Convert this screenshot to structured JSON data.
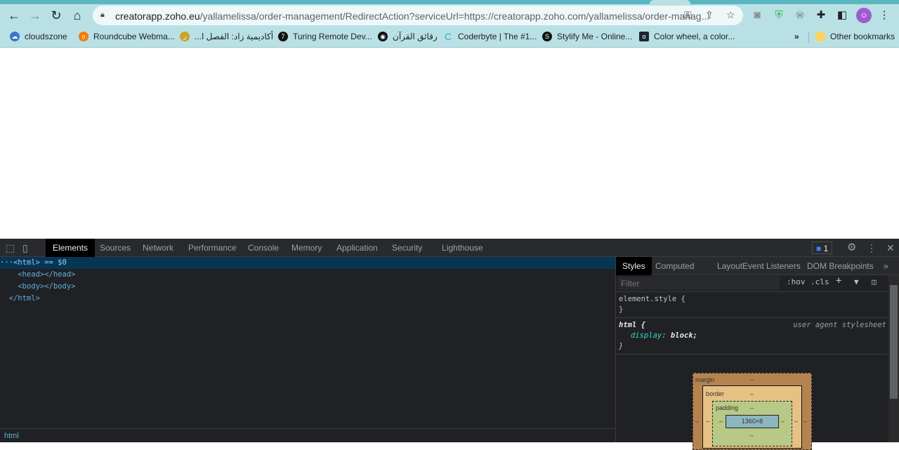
{
  "browser": {
    "url_host": "creatorapp.zoho.eu",
    "url_rest": "/yallamelissa/order-management/RedirectAction?serviceUrl=https://creatorapp.zoho.com/yallamelissa/order-manag...",
    "bookmarks": [
      {
        "label": "cloudszone",
        "icon": "cloud-icon"
      },
      {
        "label": "Roundcube Webma...",
        "icon": "roundcube-icon"
      },
      {
        "label": "أكاديمية زاد: الفصل ا...",
        "icon": "zad-icon"
      },
      {
        "label": "Turing Remote Dev...",
        "icon": "turing-icon"
      },
      {
        "label": "رقائق القرآن",
        "icon": "globe-icon"
      },
      {
        "label": "Coderbyte | The #1...",
        "icon": "coderbyte-icon"
      },
      {
        "label": "Stylify Me - Online...",
        "icon": "stylify-icon"
      },
      {
        "label": "Color wheel, a color...",
        "icon": "colorwheel-icon"
      }
    ],
    "overflow": "»",
    "other_bookmarks": "Other bookmarks"
  },
  "devtools": {
    "tabs": [
      "Elements",
      "Sources",
      "Network",
      "Performance",
      "Console",
      "Memory",
      "Application",
      "Security",
      "Lighthouse"
    ],
    "active_tab": "Elements",
    "issues_count": "1",
    "dom": [
      "···<html> == $0",
      "    <head></head>",
      "    <body></body>",
      "  </html>"
    ],
    "breadcrumb": "html",
    "side_tabs": [
      "Styles",
      "Computed",
      "Layout",
      "Event Listeners",
      "DOM Breakpoints",
      "»"
    ],
    "filter_placeholder": "Filter",
    "hov": ":hov",
    "cls": ".cls",
    "rules": {
      "element_selector": "element.style {",
      "close": "}",
      "html_selector": "html {",
      "source": "user agent stylesheet",
      "prop": "display",
      "value": "block;"
    },
    "box_model": {
      "margin": "margin",
      "border": "border",
      "padding": "padding",
      "dash": "–",
      "content": "1360×8"
    }
  },
  "colors": {
    "chrome": "#b9e1e5",
    "devtools_bg": "#202124",
    "selection": "#073655"
  }
}
